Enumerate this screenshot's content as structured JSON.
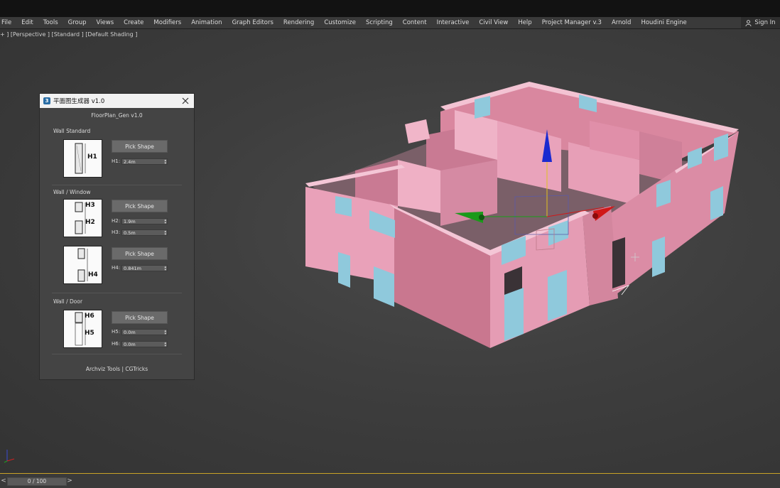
{
  "menu": {
    "items": [
      "File",
      "Edit",
      "Tools",
      "Group",
      "Views",
      "Create",
      "Modifiers",
      "Animation",
      "Graph Editors",
      "Rendering",
      "Customize",
      "Scripting",
      "Content",
      "Interactive",
      "Civil View",
      "Help",
      "Project Manager v.3",
      "Arnold",
      "Houdini Engine"
    ],
    "sign_in": "Sign In"
  },
  "viewport": {
    "label": "+ ] [Perspective ] [Standard ] [Default Shading ]"
  },
  "dialog": {
    "title": "平面图生成器 v1.0",
    "subtitle": "FloorPlan_Gen v1.0",
    "wall_standard": {
      "label": "Wall Standard",
      "button": "Pick Shape",
      "thumb_label": "H1",
      "h1_label": "H1:",
      "h1_value": "2.4m"
    },
    "wall_window": {
      "label": "Wall / Window",
      "button1": "Pick Shape",
      "thumb1_top": "H3",
      "thumb1_bottom": "H2",
      "h2_label": "H2:",
      "h2_value": "1.9m",
      "h3_label": "H3:",
      "h3_value": "0.5m",
      "button2": "Pick Shape",
      "thumb2_label": "H4",
      "h4_label": "H4:",
      "h4_value": "0.841m"
    },
    "wall_door": {
      "label": "Wall / Door",
      "button": "Pick Shape",
      "thumb_top": "H6",
      "thumb_bottom": "H5",
      "h5_label": "H5:",
      "h5_value": "0.0m",
      "h6_label": "H6:",
      "h6_value": "0.0m"
    },
    "footer": "Archviz Tools | CGTricks"
  },
  "timeline": {
    "frame": "0 / 100",
    "prev": "<",
    "next": ">"
  },
  "colors": {
    "wall_pink": "#e69bb4",
    "window_blue": "#8fc9dc",
    "gizmo_x": "#d01818",
    "gizmo_y": "#18a018",
    "gizmo_z": "#1a2ad0"
  }
}
